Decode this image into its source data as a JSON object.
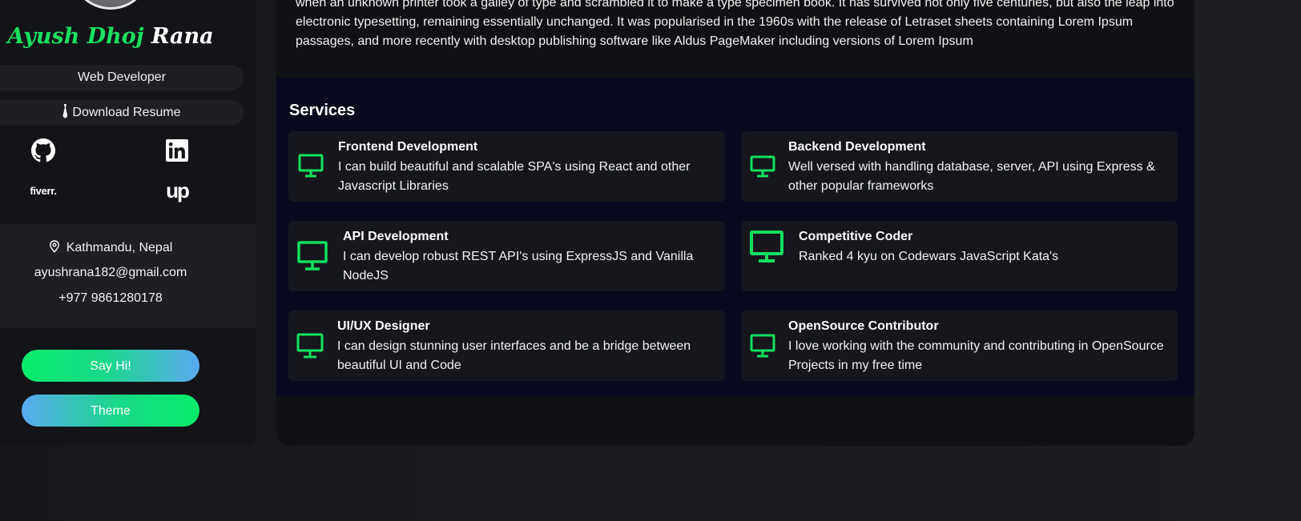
{
  "profile": {
    "first_name": "Ayush Dhoj",
    "last_name": "Rana",
    "role": "Web Developer",
    "resume_label": "Download Resume"
  },
  "socials": [
    {
      "name": "github",
      "icon": "github-icon"
    },
    {
      "name": "linkedin",
      "icon": "linkedin-icon"
    },
    {
      "name": "fiverr",
      "text": "fiverr."
    },
    {
      "name": "upwork",
      "text": "Up"
    }
  ],
  "contact": {
    "location": "Kathmandu, Nepal",
    "email": "ayushrana182@gmail.com",
    "phone": "+977 9861280178"
  },
  "buttons": {
    "say_hi": "Say Hi!",
    "theme": "Theme"
  },
  "about": {
    "text": "when an unknown printer took a galley of type and scrambled it to make a type specimen book. It has survived not only five centuries, but also the leap into electronic typesetting, remaining essentially unchanged. It was popularised in the 1960s with the release of Letraset sheets containing Lorem Ipsum passages, and more recently with desktop publishing software like Aldus PageMaker including versions of Lorem Ipsum"
  },
  "services": {
    "heading": "Services",
    "items": [
      {
        "title": "Frontend Development",
        "desc": "I can build beautiful and scalable SPA's using React and other Javascript Libraries"
      },
      {
        "title": "Backend Development",
        "desc": "Well versed with handling database, server, API using Express & other popular frameworks"
      },
      {
        "title": "API Development",
        "desc": "I can develop robust REST API's using ExpressJS and Vanilla NodeJS"
      },
      {
        "title": "Competitive Coder",
        "desc": "Ranked 4 kyu on Codewars JavaScript Kata's"
      },
      {
        "title": "UI/UX Designer",
        "desc": "I can design stunning user interfaces and be a bridge between beautiful UI and Code"
      },
      {
        "title": "OpenSource Contributor",
        "desc": "I love working with the community and contributing in OpenSource Projects in my free time"
      }
    ]
  },
  "colors": {
    "accent_green": "#19e05f",
    "accent_blue": "#5aa9f0",
    "icon_green": "#11e05f"
  }
}
